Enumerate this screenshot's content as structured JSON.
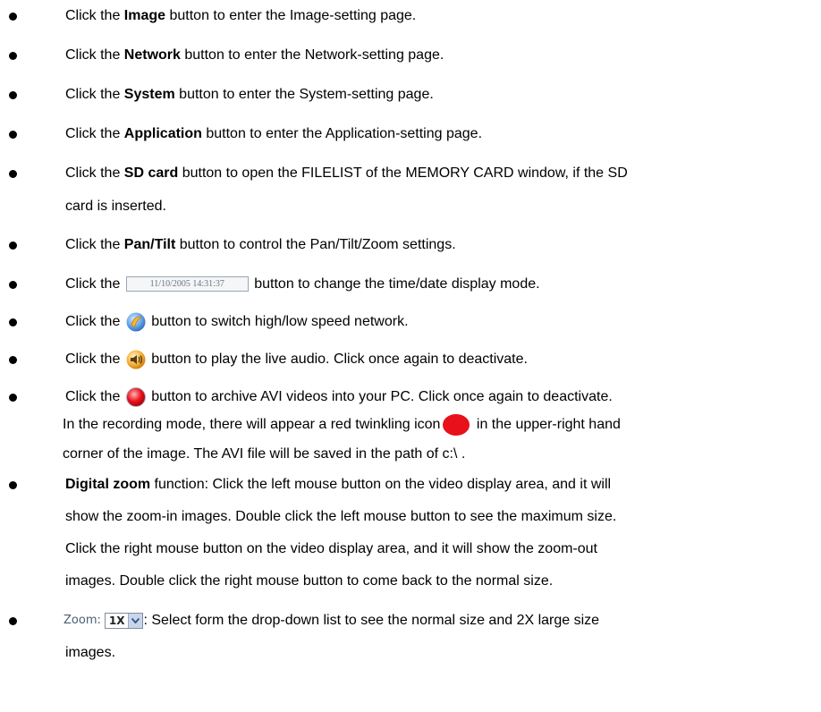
{
  "items": [
    {
      "pre": "Click the ",
      "bold": "Image",
      "post": " button to enter the Image-setting page."
    },
    {
      "pre": "Click the ",
      "bold": "Network",
      "post": " button to enter the Network-setting page."
    },
    {
      "pre": "Click the ",
      "bold": "System",
      "post": " button to enter the System-setting page."
    },
    {
      "pre": "Click the ",
      "bold": "Application",
      "post": " button to enter the Application-setting page."
    },
    {
      "pre": "Click the ",
      "bold": "SD card",
      "post": " button to open the FILELIST of the MEMORY CARD window, if the SD",
      "cont": "card is inserted."
    },
    {
      "pre": "Click the ",
      "bold": "Pan/Tilt",
      "post": " button to control the Pan/Tilt/Zoom settings."
    },
    {
      "pre": "Click the ",
      "post": " button to change the time/date display mode.",
      "button_text": "11/10/2005 14:31:37"
    },
    {
      "pre": "Click the ",
      "post": " button to switch high/low speed network.",
      "icon": "network-speed-icon"
    },
    {
      "pre": "Click the ",
      "post": " button to play the live audio. Click once again to deactivate.",
      "icon": "audio-speaker-icon"
    },
    {
      "pre": "Click the ",
      "post": " button to archive AVI videos into your PC. Click once again to deactivate.",
      "icon": "record-icon",
      "cont": "In the recording mode, there will appear a red twinkling icon",
      "cont_after": " in the upper-right hand",
      "cont2": "corner of the image. The AVI file will be saved in the path of c:\\ ."
    },
    {
      "bold": "Digital zoom",
      "post": " function: Click the left mouse button on the video display area, and it will",
      "cont": "show the zoom-in images. Double click the left mouse button to see the maximum size.",
      "cont2": "Click the right mouse button on the video display area, and it will show the zoom-out",
      "cont3": "images. Double click the right mouse button to come back to the normal size."
    },
    {
      "zoom_label": "Zoom:",
      "zoom_value": "1X",
      "post": ": Select form the drop-down list to see the normal size and 2X large size",
      "cont": "images."
    }
  ],
  "colors": {
    "record_red": "#e8101a",
    "speaker_orange": "#f2a11c",
    "network_blue": "#4a8fd8"
  }
}
